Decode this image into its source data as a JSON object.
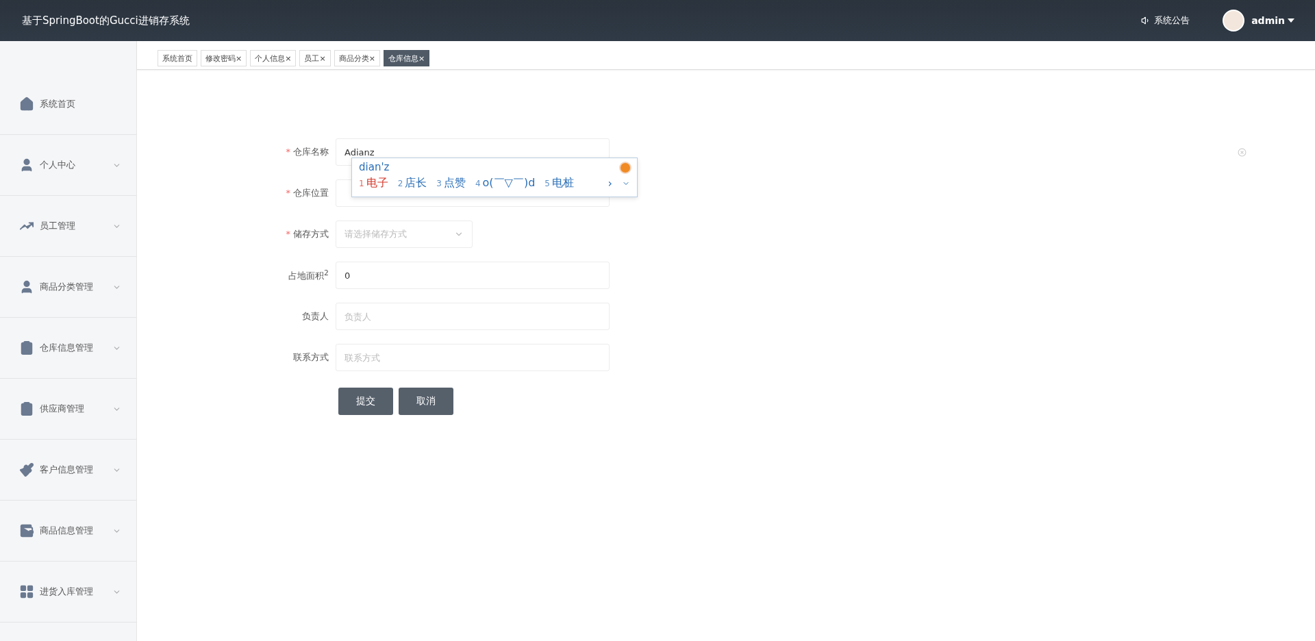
{
  "header": {
    "title": "基于SpringBoot的Gucci进销存系统",
    "notice": "系统公告",
    "user": "admin"
  },
  "tabs": [
    {
      "label": "系统首页",
      "closable": false,
      "selected": false
    },
    {
      "label": "修改密码",
      "closable": true,
      "selected": false
    },
    {
      "label": "个人信息",
      "closable": true,
      "selected": false
    },
    {
      "label": "员工",
      "closable": true,
      "selected": false
    },
    {
      "label": "商品分类",
      "closable": true,
      "selected": false
    },
    {
      "label": "仓库信息",
      "closable": true,
      "selected": true
    }
  ],
  "close_symbol": "×",
  "sidebar": {
    "items": [
      {
        "label": "系统首页",
        "expandable": false
      },
      {
        "label": "个人中心",
        "expandable": true
      },
      {
        "label": "员工管理",
        "expandable": true
      },
      {
        "label": "商品分类管理",
        "expandable": true
      },
      {
        "label": "仓库信息管理",
        "expandable": true
      },
      {
        "label": "供应商管理",
        "expandable": true
      },
      {
        "label": "客户信息管理",
        "expandable": true
      },
      {
        "label": "商品信息管理",
        "expandable": true
      },
      {
        "label": "进货入库管理",
        "expandable": true
      }
    ]
  },
  "form": {
    "fields": [
      {
        "label": "仓库名称",
        "required": true,
        "kind": "input",
        "value": "Adianz"
      },
      {
        "label": "仓库位置",
        "required": true,
        "kind": "input"
      },
      {
        "label": "储存方式",
        "required": true,
        "kind": "select",
        "placeholder": "请选择储存方式"
      },
      {
        "label": "占地面积$^{2}$",
        "required": false,
        "kind": "input",
        "value": "0"
      },
      {
        "label": "负责人",
        "required": false,
        "kind": "input",
        "placeholder": "负责人"
      },
      {
        "label": "联系方式",
        "required": false,
        "kind": "input",
        "placeholder": "联系方式"
      }
    ],
    "required_mark": "*",
    "buttons": [
      "提交",
      "取消"
    ]
  },
  "ime": {
    "composition": "dian'z",
    "candidates": [
      {
        "index": "1",
        "text": "电子",
        "selected": true
      },
      {
        "index": "2",
        "text": "店长",
        "selected": false
      },
      {
        "index": "3",
        "text": "点赞",
        "selected": false
      },
      {
        "index": "4",
        "text": "o(￣▽￣)d",
        "selected": false
      },
      {
        "index": "5",
        "text": "电桩",
        "selected": false
      }
    ],
    "next": "›"
  }
}
